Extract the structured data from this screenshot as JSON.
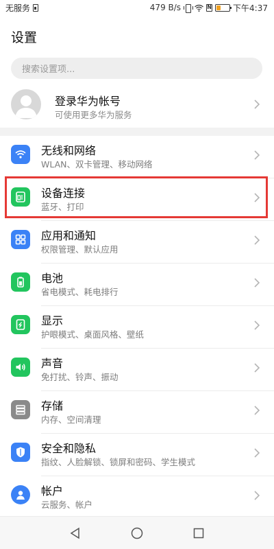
{
  "status_bar": {
    "carrier": "无服务",
    "speed": "479 B/s",
    "nfc": "N",
    "time": "下午4:37",
    "battery_level": 0.35,
    "battery_color": "#f0a020"
  },
  "page": {
    "title": "设置"
  },
  "search": {
    "placeholder": "搜索设置项..."
  },
  "account": {
    "title": "登录华为帐号",
    "subtitle": "可使用更多华为服务"
  },
  "settings": {
    "items": [
      {
        "label": "无线和网络",
        "subtitle": "WLAN、双卡管理、移动网络",
        "icon": "wifi-icon",
        "color": "#3b82f6"
      },
      {
        "label": "设备连接",
        "subtitle": "蓝牙、打印",
        "icon": "device-connection-icon",
        "color": "#22c55e"
      },
      {
        "label": "应用和通知",
        "subtitle": "权限管理、默认应用",
        "icon": "apps-grid-icon",
        "color": "#3b82f6"
      },
      {
        "label": "电池",
        "subtitle": "省电模式、耗电排行",
        "icon": "battery-icon",
        "color": "#22c55e"
      },
      {
        "label": "显示",
        "subtitle": "护眼模式、桌面风格、壁纸",
        "icon": "display-icon",
        "color": "#22c55e"
      },
      {
        "label": "声音",
        "subtitle": "免打扰、铃声、振动",
        "icon": "sound-icon",
        "color": "#22c55e"
      },
      {
        "label": "存储",
        "subtitle": "内存、空间清理",
        "icon": "storage-icon",
        "color": "#8a8a8a"
      },
      {
        "label": "安全和隐私",
        "subtitle": "指纹、人脸解锁、锁屏和密码、学生模式",
        "icon": "shield-icon",
        "color": "#3b82f6"
      },
      {
        "label": "帐户",
        "subtitle": "云服务、帐户",
        "icon": "account-icon",
        "color": "#3b82f6"
      }
    ]
  },
  "highlight": {
    "color": "#e53935",
    "item": "设备连接"
  },
  "nav": {
    "back": "back-icon",
    "home": "home-icon",
    "recents": "recents-icon"
  }
}
